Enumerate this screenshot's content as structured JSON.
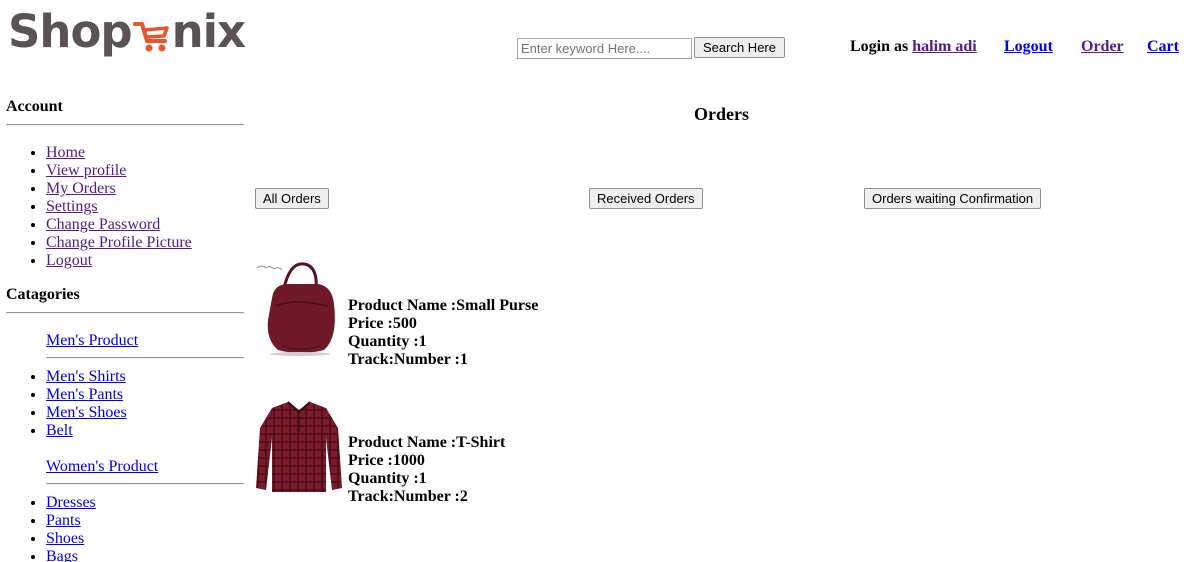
{
  "logo": {
    "text_left": "Shop",
    "text_right": "nix"
  },
  "search": {
    "placeholder": "Enter keyword Here....",
    "button_label": "Search Here"
  },
  "topnav": {
    "login_prefix": "Login as",
    "username": "halim adi",
    "logout": "Logout",
    "order": "Order",
    "cart": "Cart"
  },
  "sidebar": {
    "account_heading": "Account",
    "account_links": [
      "Home",
      "View profile",
      "My Orders",
      "Settings",
      "Change Password",
      "Change Profile Picture",
      "Logout"
    ],
    "categories_heading": "Catagories",
    "mens_heading": "Men's Product",
    "mens_links": [
      "Men's Shirts",
      "Men's Pants",
      "Men's Shoes",
      "Belt"
    ],
    "womens_heading": "Women's Product",
    "womens_links": [
      "Dresses",
      "Pants",
      "Shoes",
      "Bags"
    ]
  },
  "main": {
    "title": "Orders",
    "tabs": [
      "All Orders",
      "Received Orders",
      "Orders waiting Confirmation"
    ],
    "orders": [
      {
        "name_label": "Product Name :Small Purse",
        "price_label": "Price :500",
        "quantity_label": "Quantity :1",
        "track_label": "Track:Number :1",
        "image": "purse-image"
      },
      {
        "name_label": "Product Name :T-Shirt",
        "price_label": "Price :1000",
        "quantity_label": "Quantity :1",
        "track_label": "Track:Number :2",
        "image": "shirt-image"
      }
    ]
  },
  "colors": {
    "link": "#0000ee",
    "visited": "#551a8b",
    "logo_gray": "#5b5258",
    "logo_orange": "#e8552a"
  }
}
